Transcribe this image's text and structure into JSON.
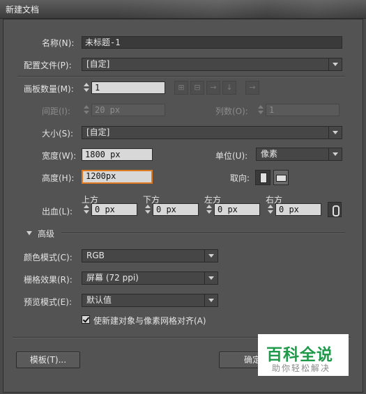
{
  "window": {
    "title": "新建文档"
  },
  "name": {
    "label": "名称(N):",
    "value": "未标题-1"
  },
  "profile": {
    "label": "配置文件(P):",
    "value": "[自定]"
  },
  "artboards": {
    "label": "画板数量(M):",
    "value": "1"
  },
  "spacing": {
    "label": "间距(I):",
    "value": "20 px"
  },
  "columns": {
    "label": "列数(O):",
    "value": "1"
  },
  "size": {
    "label": "大小(S):",
    "value": "[自定]"
  },
  "width": {
    "label": "宽度(W):",
    "value": "1800 px"
  },
  "units": {
    "label": "单位(U):",
    "value": "像素"
  },
  "height": {
    "label": "高度(H):",
    "value": "1200px"
  },
  "orientation": {
    "label": "取向:"
  },
  "bleed": {
    "label": "出血(L):",
    "top": {
      "label": "上方",
      "value": "0 px"
    },
    "bottom": {
      "label": "下方",
      "value": "0 px"
    },
    "left": {
      "label": "左方",
      "value": "0 px"
    },
    "right": {
      "label": "右方",
      "value": "0 px"
    }
  },
  "advanced": {
    "label": "高级"
  },
  "color_mode": {
    "label": "颜色模式(C):",
    "value": "RGB"
  },
  "raster_effects": {
    "label": "栅格效果(R):",
    "value": "屏幕 (72 ppi)"
  },
  "preview_mode": {
    "label": "预览模式(E):",
    "value": "默认值"
  },
  "align_pixel": {
    "label": "使新建对象与像素网格对齐(A)",
    "checked": true
  },
  "buttons": {
    "template": "模板(T)...",
    "ok": "确定"
  },
  "watermark": {
    "brand": "百科全说",
    "tagline": "助你轻松解决"
  },
  "icons": {
    "spin": "spinner-arrows-icon",
    "grid_by_row": "grid-by-row-icon",
    "grid_by_col": "grid-by-column-icon",
    "arrange_row": "arrange-by-row-icon",
    "arrange_col": "arrange-by-column-icon",
    "rtl": "right-to-left-icon",
    "link": "link-icon"
  },
  "colors": {
    "focus": "#e07a20",
    "watermark_green": "#1f9a4a"
  }
}
